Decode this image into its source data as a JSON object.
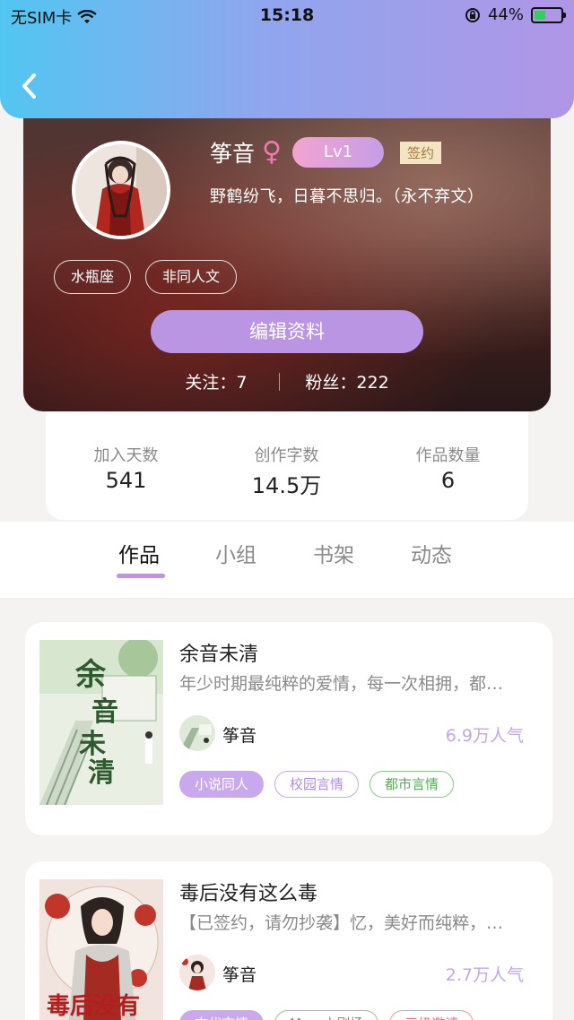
{
  "status_bar": {
    "carrier": "无SIM卡",
    "time": "15:18",
    "battery": "44%",
    "battery_level": 0.44
  },
  "profile": {
    "name": "筝音",
    "gender_symbol": "♀",
    "level": "Lv1",
    "badge": "签约",
    "motto": "野鹤纷飞，日暮不思归。（永不弃文）",
    "tags": [
      "水瓶座",
      "非同人文"
    ],
    "edit_label": "编辑资料",
    "following": "关注：7",
    "followers": "粉丝：222"
  },
  "stats": [
    {
      "label": "加入天数",
      "value": "541"
    },
    {
      "label": "创作字数",
      "value": "14.5万"
    },
    {
      "label": "作品数量",
      "value": "6"
    }
  ],
  "tabs": [
    "作品",
    "小组",
    "书架",
    "动态"
  ],
  "active_tab": "作品",
  "works": [
    {
      "title": "余音未清",
      "desc": "年少时期最纯粹的爱情，每一次相拥，都…",
      "author": "筝音",
      "popularity": "6.9万人气",
      "tags": [
        "小说同人",
        "校园言情",
        "都市言情"
      ]
    },
    {
      "title": "毒后没有这么毒",
      "desc": "【已签约，请勿抄袭】忆，美好而纯粹，…",
      "author": "筝音",
      "popularity": "2.7万人气",
      "tags": [
        "古代言情",
        "Mary小剧场",
        "三级邀请"
      ]
    }
  ],
  "colors": {
    "accent": "#b995e3",
    "header_start": "#52c6f1",
    "header_end": "#b096e6"
  }
}
